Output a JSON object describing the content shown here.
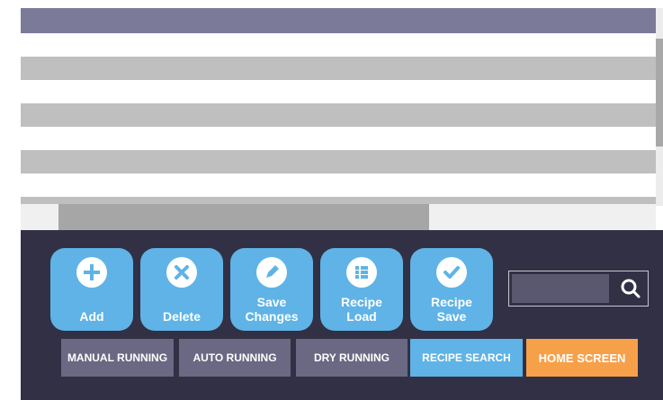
{
  "actions": {
    "add_label": "Add",
    "delete_label": "Delete",
    "save_changes_label": "Save\nChanges",
    "recipe_load_label": "Recipe\nLoad",
    "recipe_save_label": "Recipe\nSave"
  },
  "search": {
    "value": "",
    "placeholder": ""
  },
  "modes": {
    "manual_running": "MANUAL RUNNING",
    "auto_running": "AUTO RUNNING",
    "dry_running": "DRY RUNNING",
    "recipe_search": "RECIPE SEARCH",
    "home_screen": "HOME SCREEN"
  },
  "colors": {
    "header": "#7b7b99",
    "panel": "#323045",
    "action_button": "#5fb3e6",
    "mode_button": "#6a6882",
    "recipe_search": "#5fb3e6",
    "home_screen": "#f7a04a"
  },
  "icons": {
    "add": "plus-circle-icon",
    "delete": "x-circle-icon",
    "save_changes": "pencil-circle-icon",
    "recipe_load": "list-circle-icon",
    "recipe_save": "check-circle-icon",
    "search": "magnifier-icon"
  }
}
